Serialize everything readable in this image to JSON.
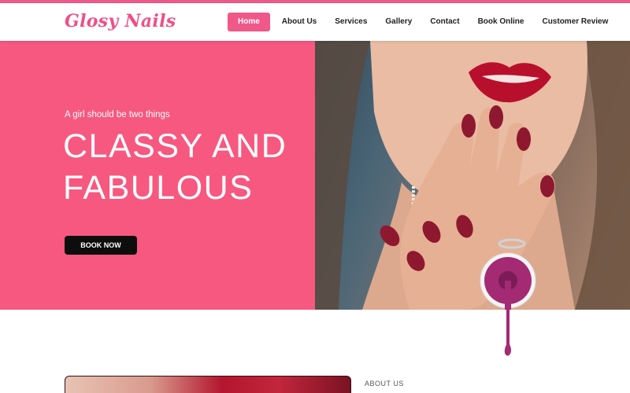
{
  "brand": {
    "logo": "Glosy Nails"
  },
  "nav": {
    "items": [
      "Home",
      "About Us",
      "Services",
      "Gallery",
      "Contact",
      "Book Online",
      "Customer Review"
    ],
    "active": "Home"
  },
  "hero": {
    "tagline": "A girl should be two things",
    "headline_line1": "CLASSY AND",
    "headline_line2": "FABULOUS",
    "cta": "BOOK NOW"
  },
  "about": {
    "label": "ABOUT US"
  },
  "colors": {
    "accent": "#f0588a",
    "hero_bg": "#f7587f",
    "button": "#0d0d0d",
    "nail_polish": "#8e1830"
  }
}
